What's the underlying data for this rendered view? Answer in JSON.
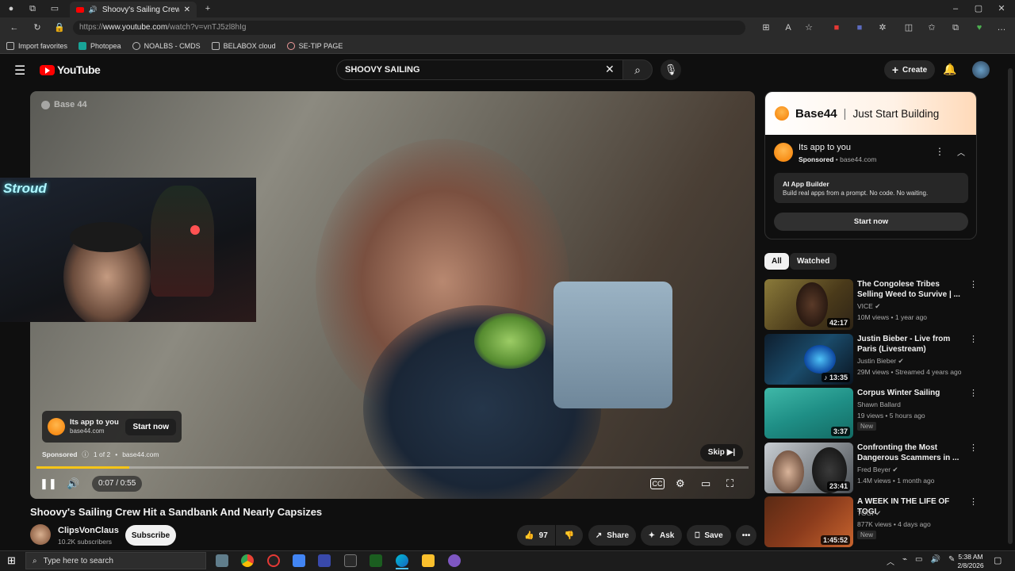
{
  "browser": {
    "tab_title": "Shoovy's Sailing Crew Hit a",
    "new_tab_label": "+",
    "url_prefix": "https://",
    "url_host": "www.youtube.com",
    "url_path": "/watch?v=vnTJ5zl8hIg",
    "bookmarks": [
      "Import favorites",
      "Photopea",
      "NOALBS - CMDS",
      "BELABOX cloud",
      "SE-TIP PAGE"
    ]
  },
  "header": {
    "logo_text": "YouTube",
    "search_value": "SHOOVY SAILING",
    "create_label": "Create"
  },
  "player": {
    "watermark": "Base 44",
    "webcam_overlay_text": "Stroud",
    "ad_card_title": "Its app to you",
    "ad_card_domain": "base44.com",
    "ad_card_button": "Start now",
    "sponsored_label": "Sponsored",
    "ad_position": "1 of 2",
    "ad_domain": "base44.com",
    "skip_label": "Skip",
    "time": "0:07 / 0:55",
    "progress_fraction": 0.13
  },
  "video": {
    "title": "Shoovy's Sailing Crew Hit a Sandbank And Nearly Capsizes",
    "channel": "ClipsVonClaus",
    "subscribers": "10.2K subscribers",
    "subscribe_label": "Subscribe",
    "likes": "97",
    "share_label": "Share",
    "ask_label": "Ask",
    "save_label": "Save"
  },
  "sidebar_ad": {
    "banner_brand": "Base44",
    "banner_tagline": "Just Start Building",
    "title": "Its app to you",
    "sponsored": "Sponsored",
    "domain": "base44.com",
    "product_title": "AI App Builder",
    "product_desc": "Build real apps from a prompt. No code. No waiting.",
    "cta": "Start now"
  },
  "filters": [
    "All",
    "Watched"
  ],
  "recommendations": [
    {
      "title": "The Congolese Tribes Selling Weed to Survive | ...",
      "channel": "VICE",
      "meta": "10M views • 1 year ago",
      "duration": "42:17",
      "badge": "",
      "thumb_color": "#6b5a2e"
    },
    {
      "title": "Justin Bieber - Live from Paris (Livestream)",
      "channel": "Justin Bieber",
      "meta": "29M views • Streamed 4 years ago",
      "duration": "13:35",
      "badge": "",
      "thumb_color": "#123247"
    },
    {
      "title": "Corpus Winter Sailing",
      "channel": "Shawn Ballard",
      "meta": "19 views • 5 hours ago",
      "duration": "3:37",
      "badge": "New",
      "thumb_color": "#1f8f86"
    },
    {
      "title": "Confronting the Most Dangerous Scammers in ...",
      "channel": "Fred Beyer",
      "meta": "1.4M views • 1 month ago",
      "duration": "23:41",
      "badge": "",
      "thumb_color": "#8a8f94"
    },
    {
      "title": "A WEEK IN THE LIFE OF TOGI",
      "channel": "TOGI",
      "meta": "877K views • 4 days ago",
      "duration": "1:45:52",
      "badge": "New",
      "thumb_color": "#8a3b1c"
    }
  ],
  "taskbar": {
    "search_placeholder": "Type here to search",
    "time": "5:38 AM",
    "date": "2/8/2026"
  },
  "colors": {
    "accent": "#ff0000",
    "progress": "#f5c518",
    "background": "#0f0f0f"
  }
}
